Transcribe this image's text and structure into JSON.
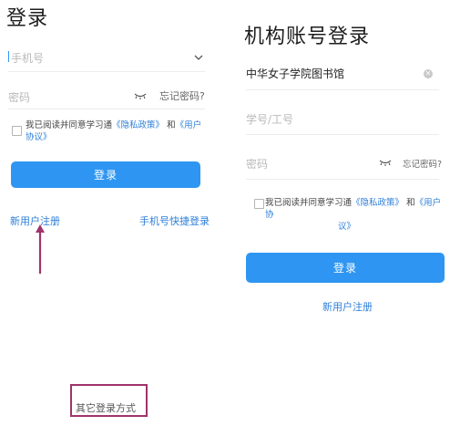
{
  "left": {
    "title": "登录",
    "phone_placeholder": "手机号",
    "password_placeholder": "密码",
    "forgot_password": "忘记密码?",
    "agree_prefix": "我已阅读并同意学习通",
    "privacy_link": "《隐私政策》",
    "agree_and": "和",
    "terms_link_1": "《用户",
    "terms_link_2": "协议》",
    "login_button": "登录",
    "register_link": "新用户注册",
    "phone_quick_login": "手机号快捷登录",
    "other_login": "其它登录方式"
  },
  "right": {
    "title": "机构账号登录",
    "institution_value": "中华女子学院图书馆",
    "student_id_placeholder": "学号/工号",
    "password_placeholder": "密码",
    "forgot_password": "忘记密码?",
    "agree_prefix": "我已阅读并同意学习通",
    "privacy_link": "《隐私政策》",
    "agree_and": "和",
    "terms_link_1": "《用户协",
    "terms_link_2": "议》",
    "login_button": "登录",
    "register_link": "新用户注册"
  },
  "colors": {
    "accent": "#2e96f2",
    "link": "#2e7fd8",
    "annotation_arrow": "#a0336c",
    "annotation_box": "#a0336c"
  }
}
